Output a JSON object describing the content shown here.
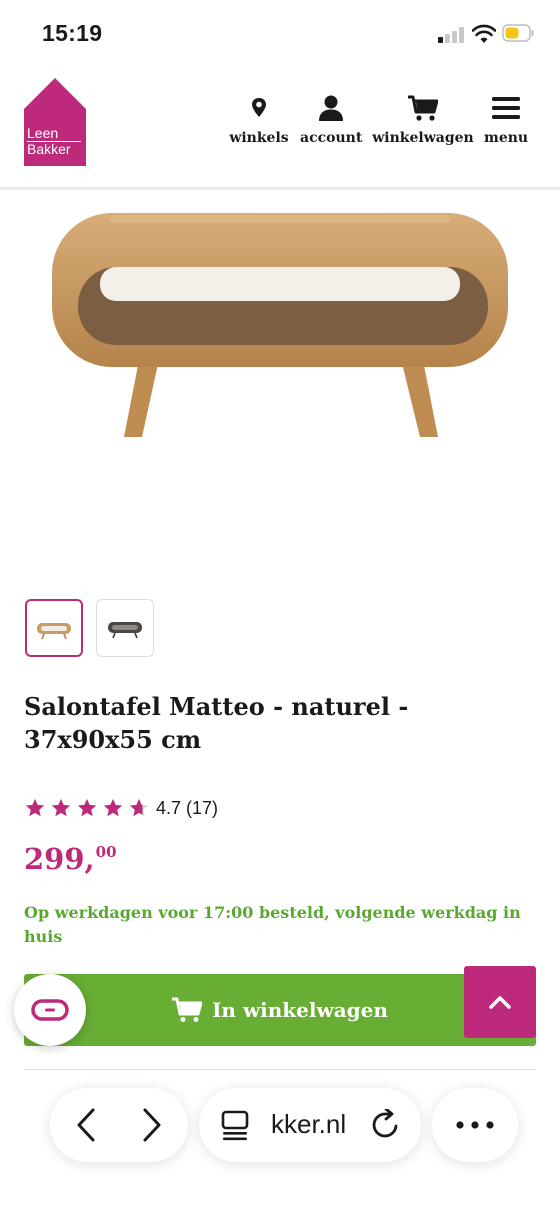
{
  "status_bar": {
    "time": "15:19",
    "battery_color": "#f5c518"
  },
  "header": {
    "logo": {
      "line1": "Leen",
      "line2": "Bakker"
    },
    "nav": [
      {
        "label": "winkels",
        "icon": "location-pin-icon"
      },
      {
        "label": "account",
        "icon": "user-icon"
      },
      {
        "label": "winkelwagen",
        "icon": "cart-icon"
      },
      {
        "label": "menu",
        "icon": "hamburger-menu-icon"
      }
    ]
  },
  "product": {
    "title": "Salontafel Matteo - naturel - 37x90x55 cm",
    "rating": {
      "stars": 4.7,
      "text": "4.7 (17)"
    },
    "price": {
      "main": "299,",
      "cents": "00"
    },
    "delivery": "Op werkdagen voor 17:00 besteld, volgende werkdag in huis",
    "add_to_cart_label": "In winkelwagen",
    "thumbnails": [
      {
        "variant": "naturel",
        "selected": true
      },
      {
        "variant": "donker",
        "selected": false
      }
    ]
  },
  "browser": {
    "url": "kker.nl"
  },
  "colors": {
    "brand": "#be2a7b",
    "green": "#68ad34",
    "text": "#1a1a1a"
  }
}
